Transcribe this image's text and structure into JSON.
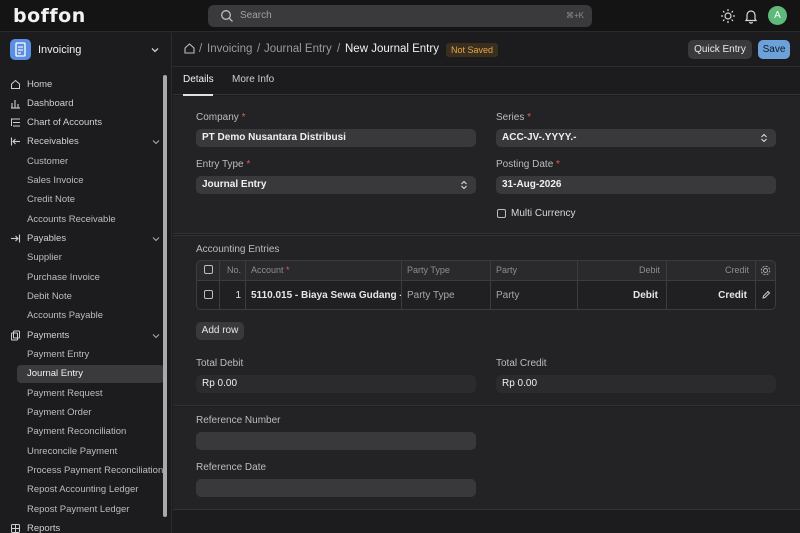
{
  "app": {
    "logo": "boffon",
    "user_initial": "A"
  },
  "search": {
    "placeholder": "Search",
    "shortcut": "⌘+K"
  },
  "sidebar": {
    "workspace": "Invoicing",
    "items": [
      {
        "label": "Home",
        "icon": "home-icon"
      },
      {
        "label": "Dashboard",
        "icon": "bar-chart-icon"
      },
      {
        "label": "Chart of Accounts",
        "icon": "list-tree-icon"
      },
      {
        "label": "Receivables",
        "icon": "arrow-in-icon"
      },
      {
        "label": "Customer"
      },
      {
        "label": "Sales Invoice"
      },
      {
        "label": "Credit Note"
      },
      {
        "label": "Accounts Receivable"
      },
      {
        "label": "Payables",
        "icon": "arrow-out-icon"
      },
      {
        "label": "Supplier"
      },
      {
        "label": "Purchase Invoice"
      },
      {
        "label": "Debit Note"
      },
      {
        "label": "Accounts Payable"
      },
      {
        "label": "Payments",
        "icon": "payments-icon"
      },
      {
        "label": "Payment Entry"
      },
      {
        "label": "Journal Entry"
      },
      {
        "label": "Payment Request"
      },
      {
        "label": "Payment Order"
      },
      {
        "label": "Payment Reconciliation"
      },
      {
        "label": "Unreconcile Payment"
      },
      {
        "label": "Process Payment Reconciliation"
      },
      {
        "label": "Repost Accounting Ledger"
      },
      {
        "label": "Repost Payment Ledger"
      },
      {
        "label": "Reports",
        "icon": "reports-icon"
      }
    ]
  },
  "breadcrumb": {
    "parts": [
      "Invoicing",
      "Journal Entry"
    ],
    "current": "New Journal Entry",
    "status": "Not Saved"
  },
  "actions": {
    "quick_entry": "Quick Entry",
    "save": "Save"
  },
  "tabs": [
    "Details",
    "More Info"
  ],
  "form": {
    "company_label": "Company",
    "company_value": "PT Demo Nusantara Distribusi",
    "series_label": "Series",
    "series_value": "ACC-JV-.YYYY.-",
    "entry_type_label": "Entry Type",
    "entry_type_value": "Journal Entry",
    "posting_date_label": "Posting Date",
    "posting_date_value": "31-Aug-2026",
    "multi_currency_label": "Multi Currency",
    "required_mark": "*"
  },
  "accounting": {
    "section_label": "Accounting Entries",
    "columns": [
      "No.",
      "Account",
      "Party Type",
      "Party",
      "Debit",
      "Credit"
    ],
    "rows": [
      {
        "no": "1",
        "account": "5110.015 - Biaya Sewa Gudang -",
        "party_type": "Party Type",
        "party": "Party",
        "debit": "Debit",
        "credit": "Credit"
      }
    ],
    "add_row": "Add row"
  },
  "totals": {
    "debit_label": "Total Debit",
    "debit_value": "Rp 0.00",
    "credit_label": "Total Credit",
    "credit_value": "Rp 0.00"
  },
  "reference": {
    "number_label": "Reference Number",
    "number_value": "",
    "date_label": "Reference Date",
    "date_value": ""
  },
  "colors": {
    "accent": "#6da2d8",
    "required": "#e05b5b",
    "warning": "#e3a84a",
    "avatar": "#5fb97a"
  }
}
